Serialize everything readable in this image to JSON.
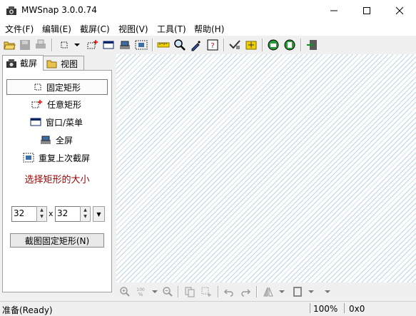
{
  "window": {
    "title": "MWSnap 3.0.0.74",
    "controls": [
      "minimize",
      "maximize",
      "close"
    ]
  },
  "menu": [
    "文件(F)",
    "编辑(E)",
    "截屏(C)",
    "视图(V)",
    "工具(T)",
    "帮助(H)"
  ],
  "tabs": [
    {
      "label": "截屏",
      "icon": "camera-icon"
    },
    {
      "label": "视图",
      "icon": "folder-open-icon"
    }
  ],
  "capture_items": [
    {
      "label": "固定矩形",
      "icon": "fixed-rect-icon",
      "selected": true
    },
    {
      "label": "任意矩形",
      "icon": "any-rect-icon",
      "selected": false
    },
    {
      "label": "窗口/菜单",
      "icon": "window-icon",
      "selected": false
    },
    {
      "label": "全屏",
      "icon": "fullscreen-icon",
      "selected": false
    },
    {
      "label": "重复上次截屏",
      "icon": "repeat-icon",
      "selected": false
    }
  ],
  "size": {
    "header": "选择矩形的大小",
    "width": "32",
    "x": "x",
    "height": "32"
  },
  "capture_button": "截图固定矩形(N)",
  "status": {
    "text": "准备(Ready)",
    "zoom": "100%",
    "coords": "0x0"
  },
  "colors": {
    "canvas_stripe": "#bcd4e6",
    "size_header": "#9b0000"
  }
}
